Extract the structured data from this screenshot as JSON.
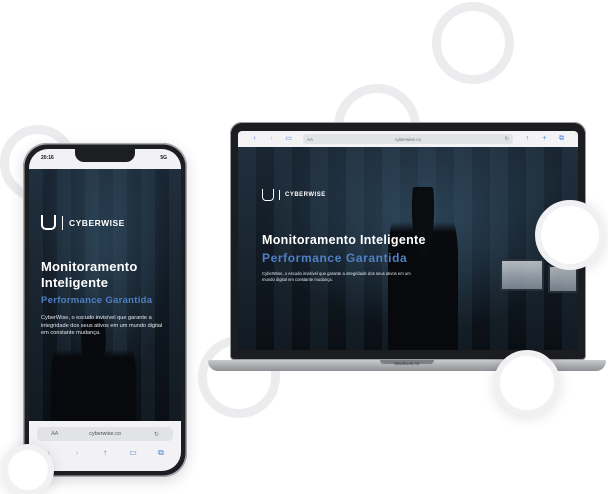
{
  "brand": {
    "name": "CYBERWISE"
  },
  "hero": {
    "title": "Monitoramento Inteligente",
    "title_phone_line1": "Monitoramento",
    "title_phone_line2": "Inteligente",
    "subtitle": "Performance Garantida",
    "description": "CyberWise, o escudo invisível que garante a integridade dos seus ativos em um mundo digital em constante mudança."
  },
  "laptop": {
    "browser": {
      "url": "cyberwise.co",
      "text_size_label": "AA",
      "icons": [
        "back-icon",
        "forward-icon",
        "book-icon",
        "reload-icon",
        "share-icon",
        "add-icon",
        "tabs-icon"
      ]
    },
    "model_label": "MacBook Air"
  },
  "phone": {
    "status": {
      "time": "20:16",
      "signal": "5G"
    },
    "browser": {
      "text_size_label": "AA",
      "url": "cyberwise.co",
      "icons": [
        "back-icon",
        "forward-icon",
        "share-icon",
        "book-icon",
        "tabs-icon"
      ]
    }
  },
  "colors": {
    "accent_blue": "#4f7fc4",
    "hero_dark": "#0b1118",
    "ring_gray": "#ececef"
  }
}
